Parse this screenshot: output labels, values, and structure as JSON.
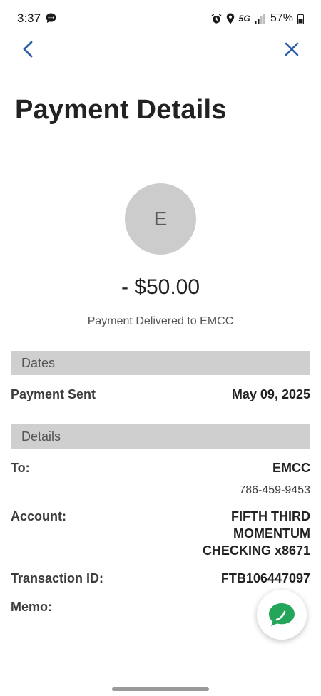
{
  "status_bar": {
    "time": "3:37",
    "network": "5G",
    "battery": "57%"
  },
  "header": {
    "title": "Payment Details"
  },
  "payment": {
    "avatar_initial": "E",
    "amount": "- $50.00",
    "status_text": "Payment Delivered to EMCC"
  },
  "dates_section": {
    "header": "Dates",
    "payment_sent_label": "Payment Sent",
    "payment_sent_value": "May 09, 2025"
  },
  "details_section": {
    "header": "Details",
    "to_label": "To:",
    "to_value": "EMCC",
    "to_phone": "786-459-9453",
    "account_label": "Account:",
    "account_line1": "FIFTH THIRD",
    "account_line2": "MOMENTUM",
    "account_line3": "CHECKING x8671",
    "transaction_label": "Transaction ID:",
    "transaction_value": "FTB106447097",
    "memo_label": "Memo:"
  },
  "icons": {
    "back": "chevron-left-icon",
    "close": "close-icon",
    "chat": "chat-bubble-icon"
  },
  "colors": {
    "accent": "#2a5ea8",
    "section_header_bg": "#cfcfcf",
    "avatar_bg": "#cccccc",
    "chat_green": "#23a55a"
  }
}
